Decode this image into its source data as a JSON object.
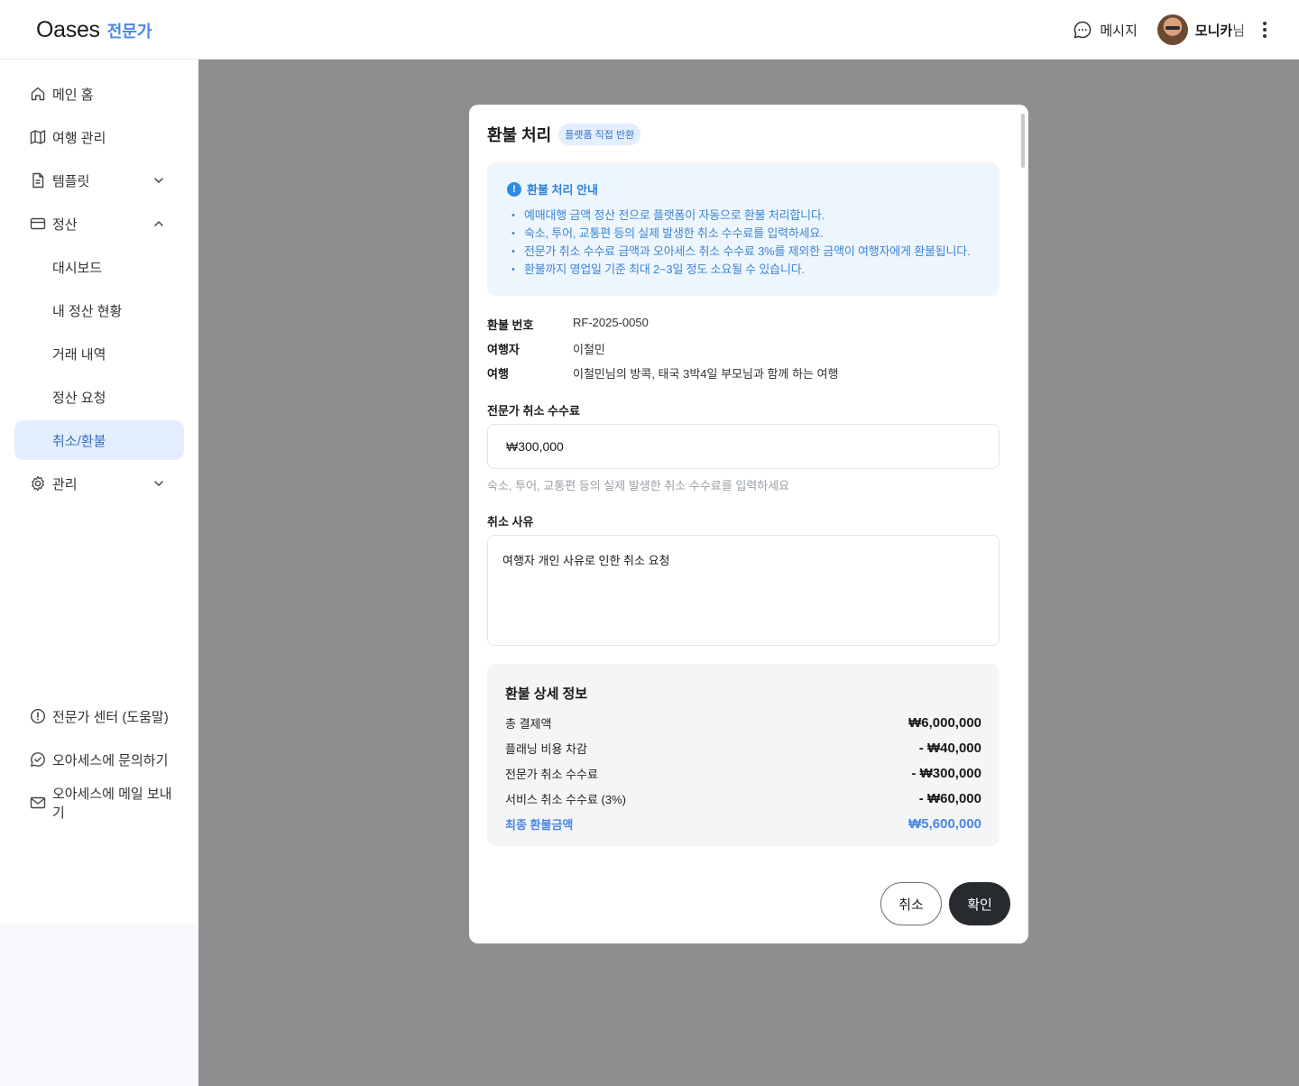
{
  "header": {
    "logo_main": "Oases",
    "logo_sub": "전문가",
    "message_label": "메시지",
    "user_name": "모니카",
    "user_suffix": "님"
  },
  "sidebar": {
    "items": [
      {
        "label": "메인 홈",
        "icon": "home-icon"
      },
      {
        "label": "여행 관리",
        "icon": "map-icon"
      },
      {
        "label": "템플릿",
        "icon": "document-icon"
      },
      {
        "label": "정산",
        "icon": "card-icon"
      },
      {
        "label": "대시보드"
      },
      {
        "label": "내 정산 현황"
      },
      {
        "label": "거래 내역"
      },
      {
        "label": "정산 요청"
      },
      {
        "label": "취소/환불",
        "active": true
      },
      {
        "label": "관리",
        "icon": "gear-icon"
      }
    ],
    "bottom": [
      {
        "label": "전문가 센터 (도움말)",
        "icon": "info-icon"
      },
      {
        "label": "오아세스에 문의하기",
        "icon": "chat-check-icon"
      },
      {
        "label": "오아세스에 메일 보내기",
        "icon": "mail-icon"
      }
    ]
  },
  "modal": {
    "title": "환불 처리",
    "chip": "플랫폼 직접 반환",
    "guide_title": "환불 처리 안내",
    "guide_items": [
      "예매대행 금액 정산 전으로 플랫폼이 자동으로 환불 처리합니다.",
      "숙소, 투어, 교통편 등의 실제 발생한 취소 수수료를 입력하세요.",
      "전문가 취소 수수료 금액과 오아세스 취소 수수료 3%를 제외한 금액이 여행자에게 환불됩니다.",
      "환불까지 영업일 기준 최대 2~3일 정도 소요될 수 있습니다."
    ],
    "refund_no_label": "환불 번호",
    "refund_no": "RF-2025-0050",
    "traveler_label": "여행자",
    "traveler": "이철민",
    "trip_label": "여행",
    "trip": "이철민님의 방콕, 태국 3박4일 부모님과 함께 하는 여행",
    "fee_label": "전문가 취소 수수료",
    "fee_value": "₩300,000",
    "fee_hint": "숙소, 투어, 교통편 등의 실제 발생한 취소 수수료를 입력하세요",
    "reason_label": "취소 사유",
    "reason_value": "여행자 개인 사유로 인한 취소 요청",
    "detail_title": "환불 상세 정보",
    "detail_rows": [
      {
        "label": "총 결제액",
        "value": "₩6,000,000"
      },
      {
        "label": "플래닝 비용 차감",
        "value": "- ₩40,000"
      },
      {
        "label": "전문가 취소 수수료",
        "value": "- ₩300,000"
      },
      {
        "label": "서비스 취소 수수료 (3%)",
        "value": "- ₩60,000"
      },
      {
        "label": "최종 환불금액",
        "value": "₩5,600,000"
      }
    ],
    "cancel_label": "취소",
    "confirm_label": "확인"
  },
  "colors": {
    "accent": "#4a86e8",
    "active_bg": "#e3efff",
    "overlay": "#8e8e90",
    "confirm_btn": "#272a2e"
  }
}
